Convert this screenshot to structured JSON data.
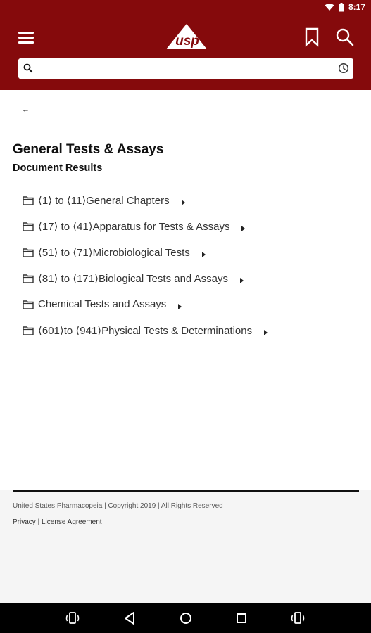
{
  "status_bar": {
    "time": "8:17"
  },
  "app": {
    "logo_text": "usp",
    "colors": {
      "brand": "#850a0c",
      "nav_bar": "#000000",
      "footer_bg": "#f5f5f5"
    }
  },
  "search": {
    "value": "",
    "placeholder": ""
  },
  "back": {
    "label": "←"
  },
  "main": {
    "title": "General Tests & Assays",
    "subtitle": "Document Results",
    "items": [
      {
        "label": "⟨1⟩ to ⟨11⟩General Chapters"
      },
      {
        "label": "⟨17⟩ to ⟨41⟩Apparatus for Tests & Assays"
      },
      {
        "label": "⟨51⟩ to ⟨71⟩Microbiological Tests"
      },
      {
        "label": "⟨81⟩ to ⟨171⟩Biological Tests and Assays"
      },
      {
        "label": "Chemical Tests and Assays"
      },
      {
        "label": "⟨601⟩to ⟨941⟩Physical Tests & Determinations"
      }
    ]
  },
  "footer": {
    "copyright": "United States Pharmacopeia |  Copyright 2019 |  All Rights Reserved",
    "privacy_label": "Privacy",
    "separator": "|",
    "license_label": "License Agreement"
  }
}
